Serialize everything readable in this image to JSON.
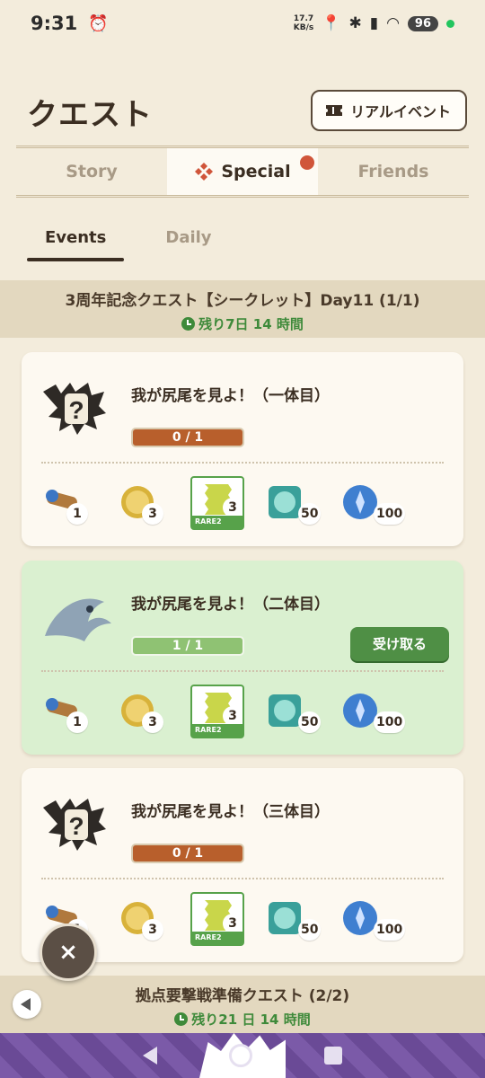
{
  "status_bar": {
    "time": "9:31",
    "speed": "17.7",
    "speed_unit": "KB/s",
    "battery": "96"
  },
  "header": {
    "title": "クエスト",
    "real_event_label": "リアルイベント"
  },
  "tabs": [
    {
      "label": "Story",
      "active": false
    },
    {
      "label": "Special",
      "active": true
    },
    {
      "label": "Friends",
      "active": false
    }
  ],
  "subtabs": [
    {
      "label": "Events",
      "active": true
    },
    {
      "label": "Daily",
      "active": false
    }
  ],
  "sections": [
    {
      "title": "3周年記念クエスト【シークレット】Day11 (1/1)",
      "timer": "残り7日 14 時間"
    },
    {
      "title": "拠点要撃戦準備クエスト (2/2)",
      "timer": "残り21 日 14 時間"
    }
  ],
  "quests": [
    {
      "title": "我が尻尾を見よ！（一体目）",
      "progress_text": "0 / 1",
      "progress": 0,
      "completed": false,
      "rewards": {
        "scope": "1",
        "coin": "3",
        "rare_label": "RARE2",
        "rare": "3",
        "gem": "50",
        "orb": "100"
      }
    },
    {
      "title": "我が尻尾を見よ！（二体目）",
      "progress_text": "1 / 1",
      "progress": 1,
      "completed": true,
      "claim_label": "受け取る",
      "rewards": {
        "scope": "1",
        "coin": "3",
        "rare_label": "RARE2",
        "rare": "3",
        "gem": "50",
        "orb": "100"
      }
    },
    {
      "title": "我が尻尾を見よ！（三体目）",
      "progress_text": "0 / 1",
      "progress": 0,
      "completed": false,
      "rewards": {
        "scope": "1",
        "coin": "3",
        "rare_label": "RARE2",
        "rare": "3",
        "gem": "50",
        "orb": "100"
      }
    }
  ],
  "close_label": "×",
  "colors": {
    "background": "#f3ecdc",
    "accent_green": "#3e8a3a",
    "progress_brown": "#b85f2c",
    "notify_red": "#d0553a"
  },
  "icons": [
    "alarm-icon",
    "ticket-icon",
    "special-icon",
    "clock-icon",
    "monster-icon",
    "scope-icon",
    "coin-icon",
    "scroll-icon",
    "gem-icon",
    "orb-icon",
    "close-icon",
    "back-arrow-icon"
  ]
}
